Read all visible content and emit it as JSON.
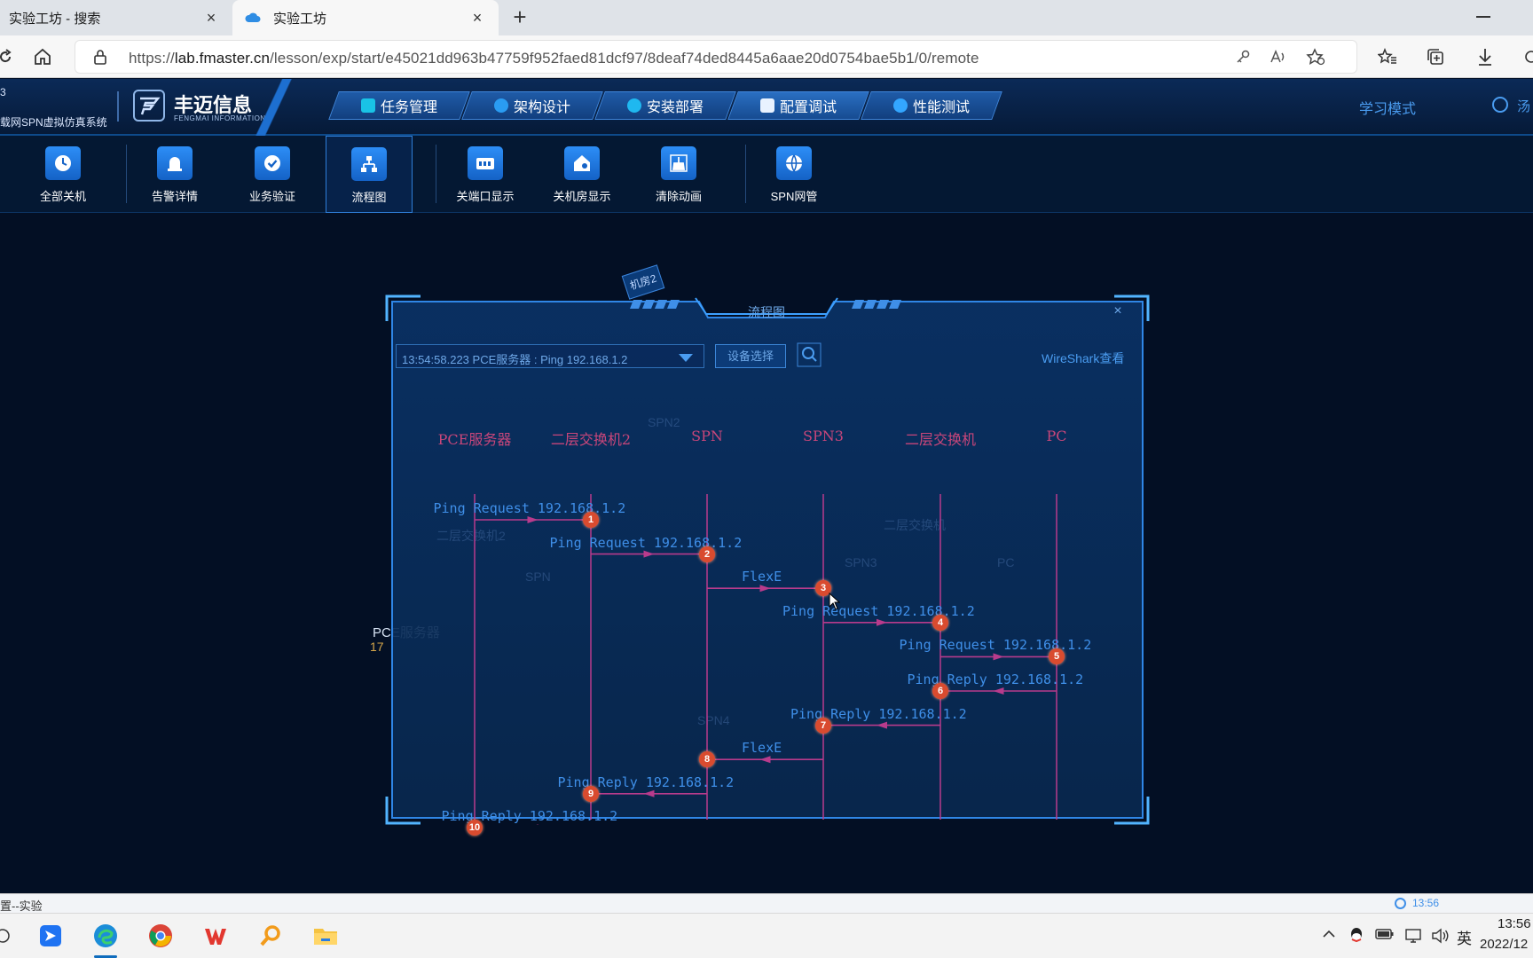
{
  "browser": {
    "tabs": [
      {
        "title": "实验工坊 - 搜索",
        "active": false
      },
      {
        "title": "实验工坊",
        "active": true
      }
    ],
    "new_tab": "+",
    "close_glyph": "×",
    "url_prefix": "https://",
    "url_host": "lab.fmaster.cn",
    "url_path": "/lesson/exp/start/e45021dd963b47759f952faed81dcf97/8deaf74ded8445a6aae20d0754bae5b1/0/remote"
  },
  "app": {
    "brand_left_partial": "载网SPN虚拟仿真系统",
    "brand_left_mark": "3",
    "brand_name": "丰迈信息",
    "brand_sub": "FENGMAI INFORMATION",
    "menu": [
      {
        "label": "任务管理",
        "icon": "task-icon",
        "color": "#19c3e6"
      },
      {
        "label": "架构设计",
        "icon": "architecture-icon",
        "color": "#2a9cf2"
      },
      {
        "label": "安装部署",
        "icon": "install-icon",
        "color": "#1fb8f0"
      },
      {
        "label": "配置调试",
        "icon": "config-icon",
        "color": "#e8f2ff"
      },
      {
        "label": "性能测试",
        "icon": "performance-icon",
        "color": "#33a6ff"
      }
    ],
    "mode_label": "学习模式",
    "user_partial": "汤"
  },
  "toolbar": {
    "items": [
      {
        "label": "全部关机",
        "icon": "power-clock-icon"
      },
      {
        "label": "告警详情",
        "icon": "alarm-icon"
      },
      {
        "label": "业务验证",
        "icon": "check-icon"
      },
      {
        "label": "流程图",
        "icon": "flowchart-icon",
        "selected": true
      },
      {
        "label": "关端口显示",
        "icon": "port-icon"
      },
      {
        "label": "关机房显示",
        "icon": "room-icon"
      },
      {
        "label": "清除动画",
        "icon": "clear-animation-icon"
      },
      {
        "label": "SPN网管",
        "icon": "network-globe-icon"
      }
    ]
  },
  "modal": {
    "title": "流程图",
    "room_tag": "机房2",
    "dropdown_value": "13:54:58.223 PCE服务器 : Ping 192.168.1.2",
    "device_select": "设备选择",
    "wireshark": "WireShark查看",
    "close_glyph": "×",
    "lanes": [
      "PCE服务器",
      "二层交换机2",
      "SPN",
      "SPN3",
      "二层交换机",
      "PC"
    ],
    "steps": [
      {
        "n": "1",
        "label": "Ping Request 192.168.1.2",
        "from": 0,
        "to": 1
      },
      {
        "n": "2",
        "label": "Ping Request 192.168.1.2",
        "from": 1,
        "to": 2
      },
      {
        "n": "3",
        "label": "FlexE",
        "from": 2,
        "to": 3
      },
      {
        "n": "4",
        "label": "Ping Request 192.168.1.2",
        "from": 3,
        "to": 4
      },
      {
        "n": "5",
        "label": "Ping Request 192.168.1.2",
        "from": 4,
        "to": 5
      },
      {
        "n": "6",
        "label": "Ping Reply 192.168.1.2",
        "from": 5,
        "to": 4
      },
      {
        "n": "7",
        "label": "Ping Reply 192.168.1.2",
        "from": 4,
        "to": 3
      },
      {
        "n": "8",
        "label": "FlexE",
        "from": 3,
        "to": 2
      },
      {
        "n": "9",
        "label": "Ping Reply 192.168.1.2",
        "from": 2,
        "to": 1
      },
      {
        "n": "10",
        "label": "Ping Reply 192.168.1.2",
        "from": 1,
        "to": 0
      }
    ],
    "background_labels": [
      "SPN2",
      "二层交换机2",
      "SPN",
      "SPN3",
      "二层交换机",
      "PC",
      "SPN4"
    ]
  },
  "behind_modal": {
    "pce_label": "PCE服务器",
    "pce_ip_partial": "17"
  },
  "status": {
    "left": "置--实验",
    "time": "13:56"
  },
  "taskbar": {
    "apps": [
      "start-icon",
      "feishu-icon",
      "edge-icon",
      "chrome-icon",
      "wps-icon",
      "search-tool-icon",
      "file-explorer-icon"
    ],
    "tray_ime": "英",
    "tray_time": "13:56",
    "tray_date": "2022/12"
  }
}
